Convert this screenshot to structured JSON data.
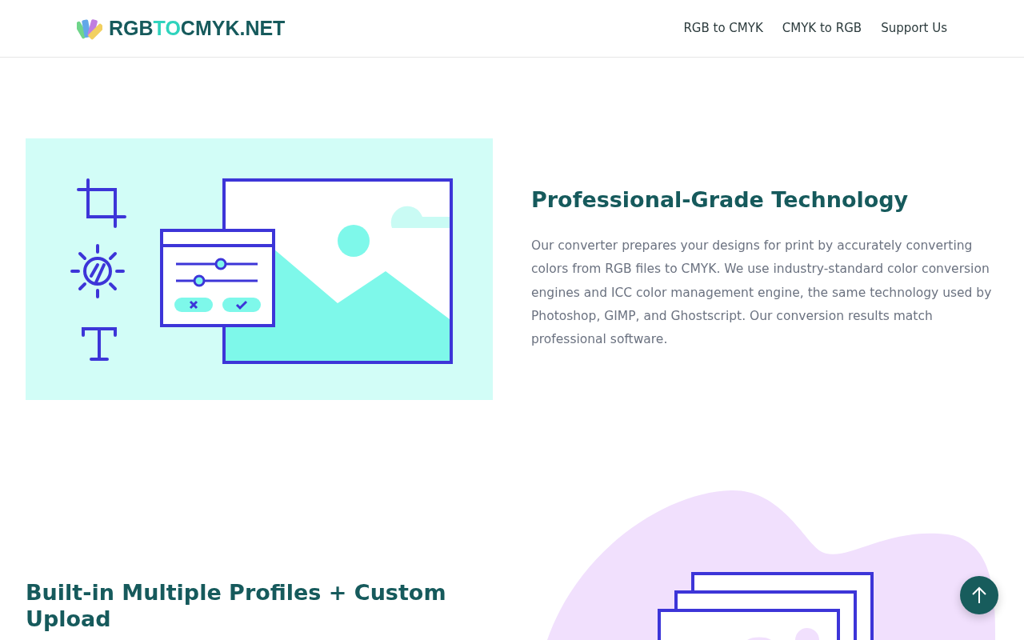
{
  "brand": {
    "parts": [
      {
        "text": "RGB",
        "accent": false
      },
      {
        "text": "TO",
        "accent": true
      },
      {
        "text": "CMYK.NET",
        "accent": false
      }
    ]
  },
  "nav": [
    {
      "label": "RGB to CMYK"
    },
    {
      "label": "CMYK to RGB"
    },
    {
      "label": "Support Us"
    }
  ],
  "features": [
    {
      "kind": "editor",
      "title": "Professional-Grade Technology",
      "text": "Our converter prepares your designs for print by accurately converting colors from RGB files to CMYK. We use industry-standard color conversion engines and ICC color management engine, the same technology used by Photoshop, GIMP, and Ghostscript. Our conversion results match professional software."
    },
    {
      "kind": "stack",
      "title": "Built-in Multiple Profiles + Custom Upload"
    }
  ]
}
